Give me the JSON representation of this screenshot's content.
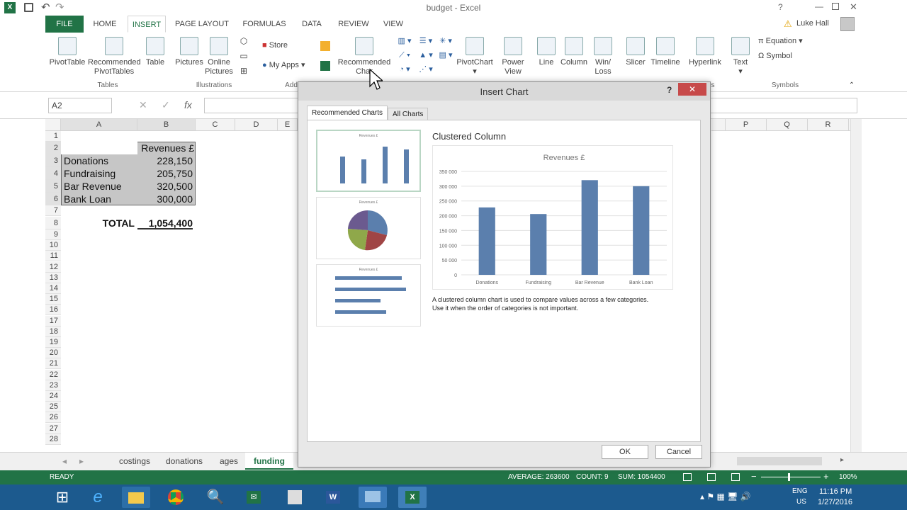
{
  "window": {
    "title": "budget - Excel",
    "help": "?",
    "user": "Luke Hall"
  },
  "ribbon_tabs": [
    "FILE",
    "HOME",
    "INSERT",
    "PAGE LAYOUT",
    "FORMULAS",
    "DATA",
    "REVIEW",
    "VIEW"
  ],
  "active_tab": "INSERT",
  "ribbon": {
    "pivottable": "PivotTable",
    "rec_pivot_1": "Recommended",
    "rec_pivot_2": "PivotTables",
    "table": "Table",
    "pictures": "Pictures",
    "online_1": "Online",
    "online_2": "Pictures",
    "store": "Store",
    "myapps": "My Apps",
    "rec_charts_1": "Recommended",
    "rec_charts_2": "Char",
    "pivotchart": "PivotChart",
    "powerview_1": "Power",
    "powerview_2": "View",
    "line": "Line",
    "column": "Column",
    "winloss_1": "Win/",
    "winloss_2": "Loss",
    "slicer": "Slicer",
    "timeline": "Timeline",
    "hyperlink": "Hyperlink",
    "text": "Text",
    "equation": "Equation",
    "symbol": "Symbol",
    "group_tables": "Tables",
    "group_illustrations": "Illustrations",
    "group_addins": "Add",
    "group_filters": "s",
    "group_symbols": "Symbols"
  },
  "formula_bar": {
    "name_box": "A2",
    "fx": "fx",
    "formula": ""
  },
  "columns_left": [
    "A",
    "B",
    "C",
    "D",
    "E"
  ],
  "columns_right": [
    "P",
    "Q",
    "R"
  ],
  "rows": [
    "1",
    "2",
    "3",
    "4",
    "5",
    "6",
    "7",
    "8",
    "9",
    "10",
    "11",
    "12",
    "13",
    "14",
    "15",
    "16",
    "17",
    "18",
    "19",
    "20",
    "21",
    "22",
    "23",
    "24",
    "25",
    "26",
    "27",
    "28"
  ],
  "cells": {
    "b2": "Revenues £",
    "a3": "Donations",
    "b3": "228,150",
    "a4": "Fundraising",
    "b4": "205,750",
    "a5": "Bar Revenue",
    "b5": "320,500",
    "a6": "Bank Loan",
    "b6": "300,000",
    "a8": "TOTAL",
    "b8": "1,054,400"
  },
  "sheet_tabs": [
    "costings",
    "donations",
    "ages",
    "funding"
  ],
  "active_sheet": "funding",
  "status": {
    "mode": "READY",
    "average": "AVERAGE: 263600",
    "count": "COUNT: 9",
    "sum": "SUM: 1054400",
    "zoom": "100%"
  },
  "taskbar": {
    "lang1": "ENG",
    "lang2": "US",
    "time": "11:16 PM",
    "date": "1/27/2016"
  },
  "dialog": {
    "title": "Insert Chart",
    "help": "?",
    "tab_recommended": "Recommended Charts",
    "tab_all": "All Charts",
    "chart_name": "Clustered Column",
    "description_1": "A clustered column chart is used to compare values across a few categories.",
    "description_2": "Use it when the order of categories is not important.",
    "ok": "OK",
    "cancel": "Cancel",
    "thumb_title": "Revenues £"
  },
  "chart_data": {
    "type": "bar",
    "title": "Revenues £",
    "categories": [
      "Donations",
      "Fundraising",
      "Bar Revenue",
      "Bank Loan"
    ],
    "values": [
      228150,
      205750,
      320500,
      300000
    ],
    "ylim": [
      0,
      350000
    ],
    "yticks": [
      "0",
      "50 000",
      "100 000",
      "150 000",
      "200 000",
      "250 000",
      "300 000",
      "350 000"
    ],
    "grid": true,
    "color": "#5b7fad"
  },
  "colors": {
    "excel_green": "#217346",
    "dialog_close": "#c74a4a",
    "taskbar": "#1c5a8e"
  }
}
